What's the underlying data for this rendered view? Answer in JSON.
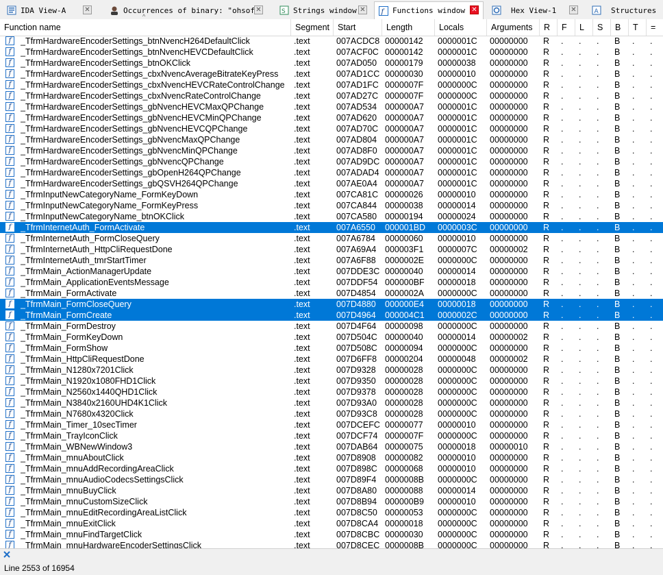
{
  "tabs": [
    {
      "label": "IDA View-A",
      "icon": "ida-view-icon",
      "active": false,
      "close_red": false
    },
    {
      "label": "Occurrences of binary: \"ohsoft\"",
      "icon": "avatar-icon",
      "active": false,
      "close_red": false
    },
    {
      "label": "Strings window",
      "icon": "strings-icon",
      "active": false,
      "close_red": false
    },
    {
      "label": "Functions window",
      "icon": "function-icon",
      "active": true,
      "close_red": true
    },
    {
      "label": "Hex View-1",
      "icon": "hex-icon",
      "active": false,
      "close_red": false
    },
    {
      "label": "Structures",
      "icon": "structures-icon",
      "active": false,
      "close_red": false
    }
  ],
  "columns": [
    "Function name",
    "Segment",
    "Start",
    "Length",
    "Locals",
    "Arguments",
    "R",
    "F",
    "L",
    "S",
    "B",
    "T",
    "="
  ],
  "rows": [
    [
      "_TfrmHardwareEncoderSettings_btnNvencH264DefaultClick",
      ".text",
      "007ACDC8",
      "00000142",
      "0000001C",
      "00000000",
      "R",
      ".",
      ".",
      ".",
      "B",
      ".",
      "."
    ],
    [
      "_TfrmHardwareEncoderSettings_btnNvencHEVCDefaultClick",
      ".text",
      "007ACF0C",
      "00000142",
      "0000001C",
      "00000000",
      "R",
      ".",
      ".",
      ".",
      "B",
      ".",
      "."
    ],
    [
      "_TfrmHardwareEncoderSettings_btnOKClick",
      ".text",
      "007AD050",
      "00000179",
      "00000038",
      "00000000",
      "R",
      ".",
      ".",
      ".",
      "B",
      ".",
      "."
    ],
    [
      "_TfrmHardwareEncoderSettings_cbxNvencAverageBitrateKeyPress",
      ".text",
      "007AD1CC",
      "00000030",
      "00000010",
      "00000000",
      "R",
      ".",
      ".",
      ".",
      "B",
      ".",
      "."
    ],
    [
      "_TfrmHardwareEncoderSettings_cbxNvencHEVCRateControlChange",
      ".text",
      "007AD1FC",
      "0000007F",
      "0000000C",
      "00000000",
      "R",
      ".",
      ".",
      ".",
      "B",
      ".",
      "."
    ],
    [
      "_TfrmHardwareEncoderSettings_cbxNvencRateControlChange",
      ".text",
      "007AD27C",
      "0000007F",
      "0000000C",
      "00000000",
      "R",
      ".",
      ".",
      ".",
      "B",
      ".",
      "."
    ],
    [
      "_TfrmHardwareEncoderSettings_gbNvencHEVCMaxQPChange",
      ".text",
      "007AD534",
      "000000A7",
      "0000001C",
      "00000000",
      "R",
      ".",
      ".",
      ".",
      "B",
      ".",
      "."
    ],
    [
      "_TfrmHardwareEncoderSettings_gbNvencHEVCMinQPChange",
      ".text",
      "007AD620",
      "000000A7",
      "0000001C",
      "00000000",
      "R",
      ".",
      ".",
      ".",
      "B",
      ".",
      "."
    ],
    [
      "_TfrmHardwareEncoderSettings_gbNvencHEVCQPChange",
      ".text",
      "007AD70C",
      "000000A7",
      "0000001C",
      "00000000",
      "R",
      ".",
      ".",
      ".",
      "B",
      ".",
      "."
    ],
    [
      "_TfrmHardwareEncoderSettings_gbNvencMaxQPChange",
      ".text",
      "007AD804",
      "000000A7",
      "0000001C",
      "00000000",
      "R",
      ".",
      ".",
      ".",
      "B",
      ".",
      "."
    ],
    [
      "_TfrmHardwareEncoderSettings_gbNvencMinQPChange",
      ".text",
      "007AD8F0",
      "000000A7",
      "0000001C",
      "00000000",
      "R",
      ".",
      ".",
      ".",
      "B",
      ".",
      "."
    ],
    [
      "_TfrmHardwareEncoderSettings_gbNvencQPChange",
      ".text",
      "007AD9DC",
      "000000A7",
      "0000001C",
      "00000000",
      "R",
      ".",
      ".",
      ".",
      "B",
      ".",
      "."
    ],
    [
      "_TfrmHardwareEncoderSettings_gbOpenH264QPChange",
      ".text",
      "007ADAD4",
      "000000A7",
      "0000001C",
      "00000000",
      "R",
      ".",
      ".",
      ".",
      "B",
      ".",
      "."
    ],
    [
      "_TfrmHardwareEncoderSettings_gbQSVH264QPChange",
      ".text",
      "007AE0A4",
      "000000A7",
      "0000001C",
      "00000000",
      "R",
      ".",
      ".",
      ".",
      "B",
      ".",
      "."
    ],
    [
      "_TfrmInputNewCategoryName_FormKeyDown",
      ".text",
      "007CA81C",
      "00000026",
      "00000010",
      "00000000",
      "R",
      ".",
      ".",
      ".",
      "B",
      ".",
      "."
    ],
    [
      "_TfrmInputNewCategoryName_FormKeyPress",
      ".text",
      "007CA844",
      "00000038",
      "00000014",
      "00000000",
      "R",
      ".",
      ".",
      ".",
      "B",
      ".",
      "."
    ],
    [
      "_TfrmInputNewCategoryName_btnOKClick",
      ".text",
      "007CA580",
      "00000194",
      "00000024",
      "00000000",
      "R",
      ".",
      ".",
      ".",
      "B",
      ".",
      "."
    ],
    [
      "_TfrmInternetAuth_FormActivate",
      ".text",
      "007A6550",
      "000001BD",
      "0000003C",
      "00000000",
      "R",
      ".",
      ".",
      ".",
      "B",
      ".",
      "."
    ],
    [
      "_TfrmInternetAuth_FormCloseQuery",
      ".text",
      "007A6784",
      "00000060",
      "00000010",
      "00000000",
      "R",
      ".",
      ".",
      ".",
      "B",
      ".",
      "."
    ],
    [
      "_TfrmInternetAuth_HttpCliRequestDone",
      ".text",
      "007A69A4",
      "000003F1",
      "0000007C",
      "00000002",
      "R",
      ".",
      ".",
      ".",
      "B",
      ".",
      "."
    ],
    [
      "_TfrmInternetAuth_tmrStartTimer",
      ".text",
      "007A6F88",
      "0000002E",
      "0000000C",
      "00000000",
      "R",
      ".",
      ".",
      ".",
      "B",
      ".",
      "."
    ],
    [
      "_TfrmMain_ActionManagerUpdate",
      ".text",
      "007DDE3C",
      "00000040",
      "00000014",
      "00000000",
      "R",
      ".",
      ".",
      ".",
      "B",
      ".",
      "."
    ],
    [
      "_TfrmMain_ApplicationEventsMessage",
      ".text",
      "007DDF54",
      "000000BF",
      "00000018",
      "00000000",
      "R",
      ".",
      ".",
      ".",
      "B",
      ".",
      "."
    ],
    [
      "_TfrmMain_FormActivate",
      ".text",
      "007D4854",
      "0000002A",
      "0000000C",
      "00000000",
      "R",
      ".",
      ".",
      ".",
      "B",
      ".",
      "."
    ],
    [
      "_TfrmMain_FormCloseQuery",
      ".text",
      "007D4880",
      "000000E4",
      "00000018",
      "00000000",
      "R",
      ".",
      ".",
      ".",
      "B",
      ".",
      "."
    ],
    [
      "_TfrmMain_FormCreate",
      ".text",
      "007D4964",
      "000004C1",
      "0000002C",
      "00000000",
      "R",
      ".",
      ".",
      ".",
      "B",
      ".",
      "."
    ],
    [
      "_TfrmMain_FormDestroy",
      ".text",
      "007D4F64",
      "00000098",
      "0000000C",
      "00000000",
      "R",
      ".",
      ".",
      ".",
      "B",
      ".",
      "."
    ],
    [
      "_TfrmMain_FormKeyDown",
      ".text",
      "007D504C",
      "00000040",
      "00000014",
      "00000002",
      "R",
      ".",
      ".",
      ".",
      "B",
      ".",
      "."
    ],
    [
      "_TfrmMain_FormShow",
      ".text",
      "007D508C",
      "00000094",
      "0000000C",
      "00000000",
      "R",
      ".",
      ".",
      ".",
      "B",
      ".",
      "."
    ],
    [
      "_TfrmMain_HttpCliRequestDone",
      ".text",
      "007D6FF8",
      "00000204",
      "00000048",
      "00000002",
      "R",
      ".",
      ".",
      ".",
      "B",
      ".",
      "."
    ],
    [
      "_TfrmMain_N1280x7201Click",
      ".text",
      "007D9328",
      "00000028",
      "0000000C",
      "00000000",
      "R",
      ".",
      ".",
      ".",
      "B",
      ".",
      "."
    ],
    [
      "_TfrmMain_N1920x1080FHD1Click",
      ".text",
      "007D9350",
      "00000028",
      "0000000C",
      "00000000",
      "R",
      ".",
      ".",
      ".",
      "B",
      ".",
      "."
    ],
    [
      "_TfrmMain_N2560x1440QHD1Click",
      ".text",
      "007D9378",
      "00000028",
      "0000000C",
      "00000000",
      "R",
      ".",
      ".",
      ".",
      "B",
      ".",
      "."
    ],
    [
      "_TfrmMain_N3840x2160UHD4K1Click",
      ".text",
      "007D93A0",
      "00000028",
      "0000000C",
      "00000000",
      "R",
      ".",
      ".",
      ".",
      "B",
      ".",
      "."
    ],
    [
      "_TfrmMain_N7680x4320Click",
      ".text",
      "007D93C8",
      "00000028",
      "0000000C",
      "00000000",
      "R",
      ".",
      ".",
      ".",
      "B",
      ".",
      "."
    ],
    [
      "_TfrmMain_Timer_10secTimer",
      ".text",
      "007DCEFC",
      "00000077",
      "00000010",
      "00000000",
      "R",
      ".",
      ".",
      ".",
      "B",
      ".",
      "."
    ],
    [
      "_TfrmMain_TrayIconClick",
      ".text",
      "007DCF74",
      "0000007F",
      "0000000C",
      "00000000",
      "R",
      ".",
      ".",
      ".",
      "B",
      ".",
      "."
    ],
    [
      "_TfrmMain_WBNewWindow3",
      ".text",
      "007DAB64",
      "00000075",
      "00000018",
      "00000010",
      "R",
      ".",
      ".",
      ".",
      "B",
      ".",
      "."
    ],
    [
      "_TfrmMain_mnuAboutClick",
      ".text",
      "007D8908",
      "00000082",
      "00000010",
      "00000000",
      "R",
      ".",
      ".",
      ".",
      "B",
      ".",
      "."
    ],
    [
      "_TfrmMain_mnuAddRecordingAreaClick",
      ".text",
      "007D898C",
      "00000068",
      "00000010",
      "00000000",
      "R",
      ".",
      ".",
      ".",
      "B",
      ".",
      "."
    ],
    [
      "_TfrmMain_mnuAudioCodecsSettingsClick",
      ".text",
      "007D89F4",
      "0000008B",
      "0000000C",
      "00000000",
      "R",
      ".",
      ".",
      ".",
      "B",
      ".",
      "."
    ],
    [
      "_TfrmMain_mnuBuyClick",
      ".text",
      "007D8A80",
      "00000088",
      "00000014",
      "00000000",
      "R",
      ".",
      ".",
      ".",
      "B",
      ".",
      "."
    ],
    [
      "_TfrmMain_mnuCustomSizeClick",
      ".text",
      "007D8B94",
      "000000B9",
      "00000010",
      "00000000",
      "R",
      ".",
      ".",
      ".",
      "B",
      ".",
      "."
    ],
    [
      "_TfrmMain_mnuEditRecordingAreaListClick",
      ".text",
      "007D8C50",
      "00000053",
      "0000000C",
      "00000000",
      "R",
      ".",
      ".",
      ".",
      "B",
      ".",
      "."
    ],
    [
      "_TfrmMain_mnuExitClick",
      ".text",
      "007D8CA4",
      "00000018",
      "0000000C",
      "00000000",
      "R",
      ".",
      ".",
      ".",
      "B",
      ".",
      "."
    ],
    [
      "_TfrmMain_mnuFindTargetClick",
      ".text",
      "007D8CBC",
      "00000030",
      "0000000C",
      "00000000",
      "R",
      ".",
      ".",
      ".",
      "B",
      ".",
      "."
    ],
    [
      "_TfrmMain_mnuHardwareEncoderSettingsClick",
      ".text",
      "007D8CEC",
      "0000008B",
      "0000000C",
      "00000000",
      "R",
      ".",
      ".",
      ".",
      "B",
      ".",
      "."
    ]
  ],
  "selected_rows": [
    17,
    24,
    25
  ],
  "status": {
    "line_text": "Line 2553 of 16954"
  },
  "colors": {
    "selection": "#0078d7",
    "icon_border": "#1e6fc8"
  }
}
